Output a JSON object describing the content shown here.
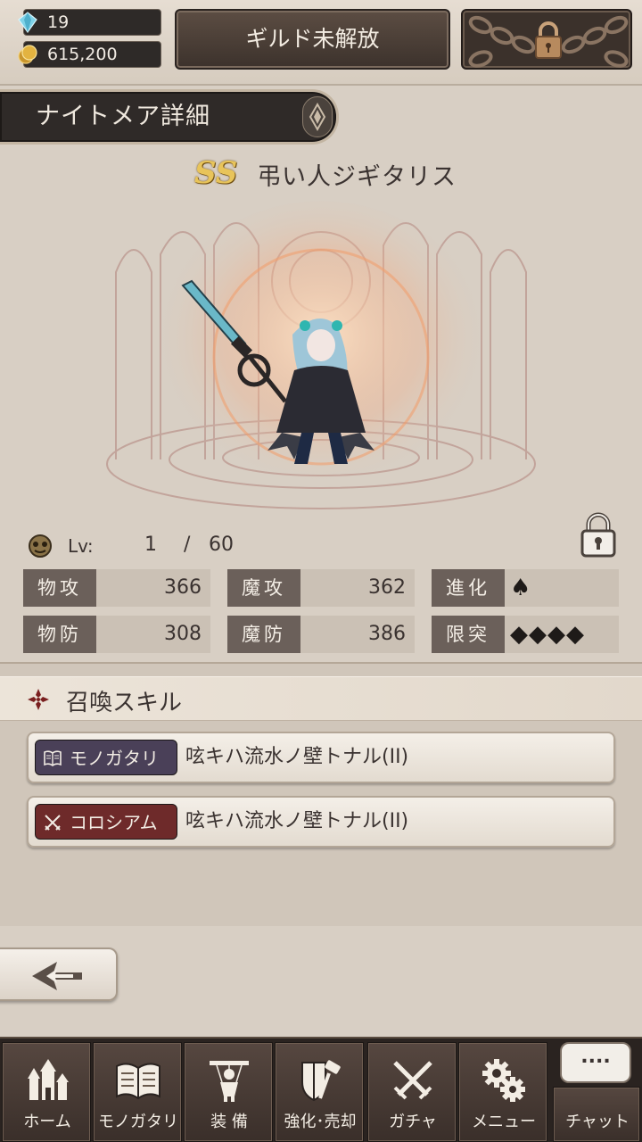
{
  "resources": {
    "gems": "19",
    "gold": "615,200"
  },
  "header": {
    "guild_button": "ギルド未解放",
    "locked_button_icon": "padlock-chain-icon"
  },
  "title_banner": "ナイトメア詳細",
  "nightmare": {
    "rank": "SS",
    "name": "弔い人ジギタリス"
  },
  "level": {
    "label": "Lv:",
    "current": "1",
    "separator": "/",
    "max": "60"
  },
  "stats": {
    "phys_atk": {
      "label": "物攻",
      "value": "366"
    },
    "mag_atk": {
      "label": "魔攻",
      "value": "362"
    },
    "evolution": {
      "label": "進化",
      "value": "♠"
    },
    "phys_def": {
      "label": "物防",
      "value": "308"
    },
    "mag_def": {
      "label": "魔防",
      "value": "386"
    },
    "limit_break": {
      "label": "限突",
      "value": "◆◆◆◆"
    }
  },
  "skills": {
    "header": "召喚スキル",
    "story": {
      "tag": "モノガタリ",
      "text": "呟キハ流水ノ壁トナル(II)"
    },
    "colosseum": {
      "tag": "コロシアム",
      "text": "呟キハ流水ノ壁トナル(II)"
    }
  },
  "nav": {
    "home": "ホーム",
    "story": "モノガタリ",
    "equip": "装 備",
    "enhance": "強化･売却",
    "gacha": "ガチャ",
    "menu": "メニュー",
    "chat": "チャット",
    "chat_bubble": "...."
  },
  "colors": {
    "story_tag": "#4a4058",
    "colosseum_tag": "#6e2a2a",
    "gold": "#e8c45a"
  }
}
